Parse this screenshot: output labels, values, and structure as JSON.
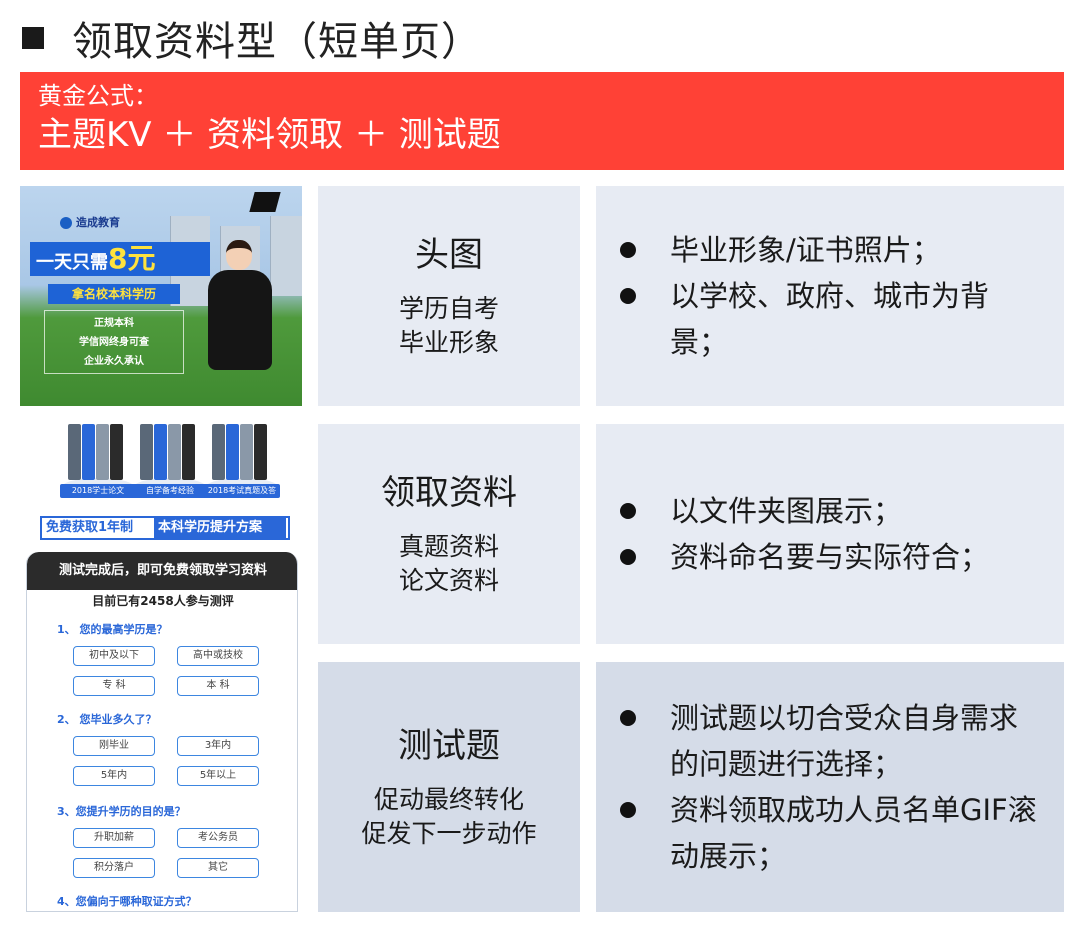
{
  "header": {
    "title": "领取资料型（短单页）"
  },
  "formula": {
    "label": "黄金公式：",
    "text": "主题KV ＋ 资料领取 ＋ 测试题"
  },
  "thumb_kv": {
    "logo": "造成教育",
    "price_prefix": "一天只需",
    "price_number": "8元",
    "subtitle": "拿名校本科学历",
    "lines": [
      "正规本科",
      "学信网终身可查",
      "企业永久承认"
    ]
  },
  "thumb_folders": {
    "tags": [
      "2018学士论文",
      "自学备考经验",
      "2018考试真题及答案"
    ],
    "promo_a": "免费获取1年制",
    "promo_b": "本科学历提升方案"
  },
  "thumb_quiz": {
    "heading": "测试完成后，即可免费领取学习资料",
    "count": "目前已有2458人参与测评",
    "questions": [
      {
        "q": "1、 您的最高学历是？",
        "options": [
          "初中及以下",
          "高中或技校",
          "专 科",
          "本 科"
        ]
      },
      {
        "q": "2、 您毕业多久了？",
        "options": [
          "刚毕业",
          "3年内",
          "5年内",
          "5年以上"
        ]
      },
      {
        "q": "3、您提升学历的目的是？",
        "options": [
          "升职加薪",
          "考公务员",
          "积分落户",
          "其它"
        ]
      },
      {
        "q": "4、您偏向于哪种取证方式？",
        "options": []
      }
    ]
  },
  "sections": [
    {
      "title": "头图",
      "subs": [
        "学历自考",
        "毕业形象"
      ],
      "bullets": [
        "毕业形象/证书照片；",
        "以学校、政府、城市为背景；"
      ]
    },
    {
      "title": "领取资料",
      "subs": [
        "真题资料",
        "论文资料"
      ],
      "bullets": [
        "以文件夹图展示；",
        "资料命名要与实际符合；"
      ]
    },
    {
      "title": "测试题",
      "subs": [
        "促动最终转化",
        "促发下一步动作"
      ],
      "bullets": [
        "测试题以切合受众自身需求的问题进行选择；",
        "资料领取成功人员名单GIF滚动展示；"
      ]
    }
  ],
  "colors": {
    "accent_red": "#ff4136",
    "card_light": "#e7ebf3",
    "card_dark": "#d5dce8",
    "brand_blue": "#2a67d8"
  }
}
